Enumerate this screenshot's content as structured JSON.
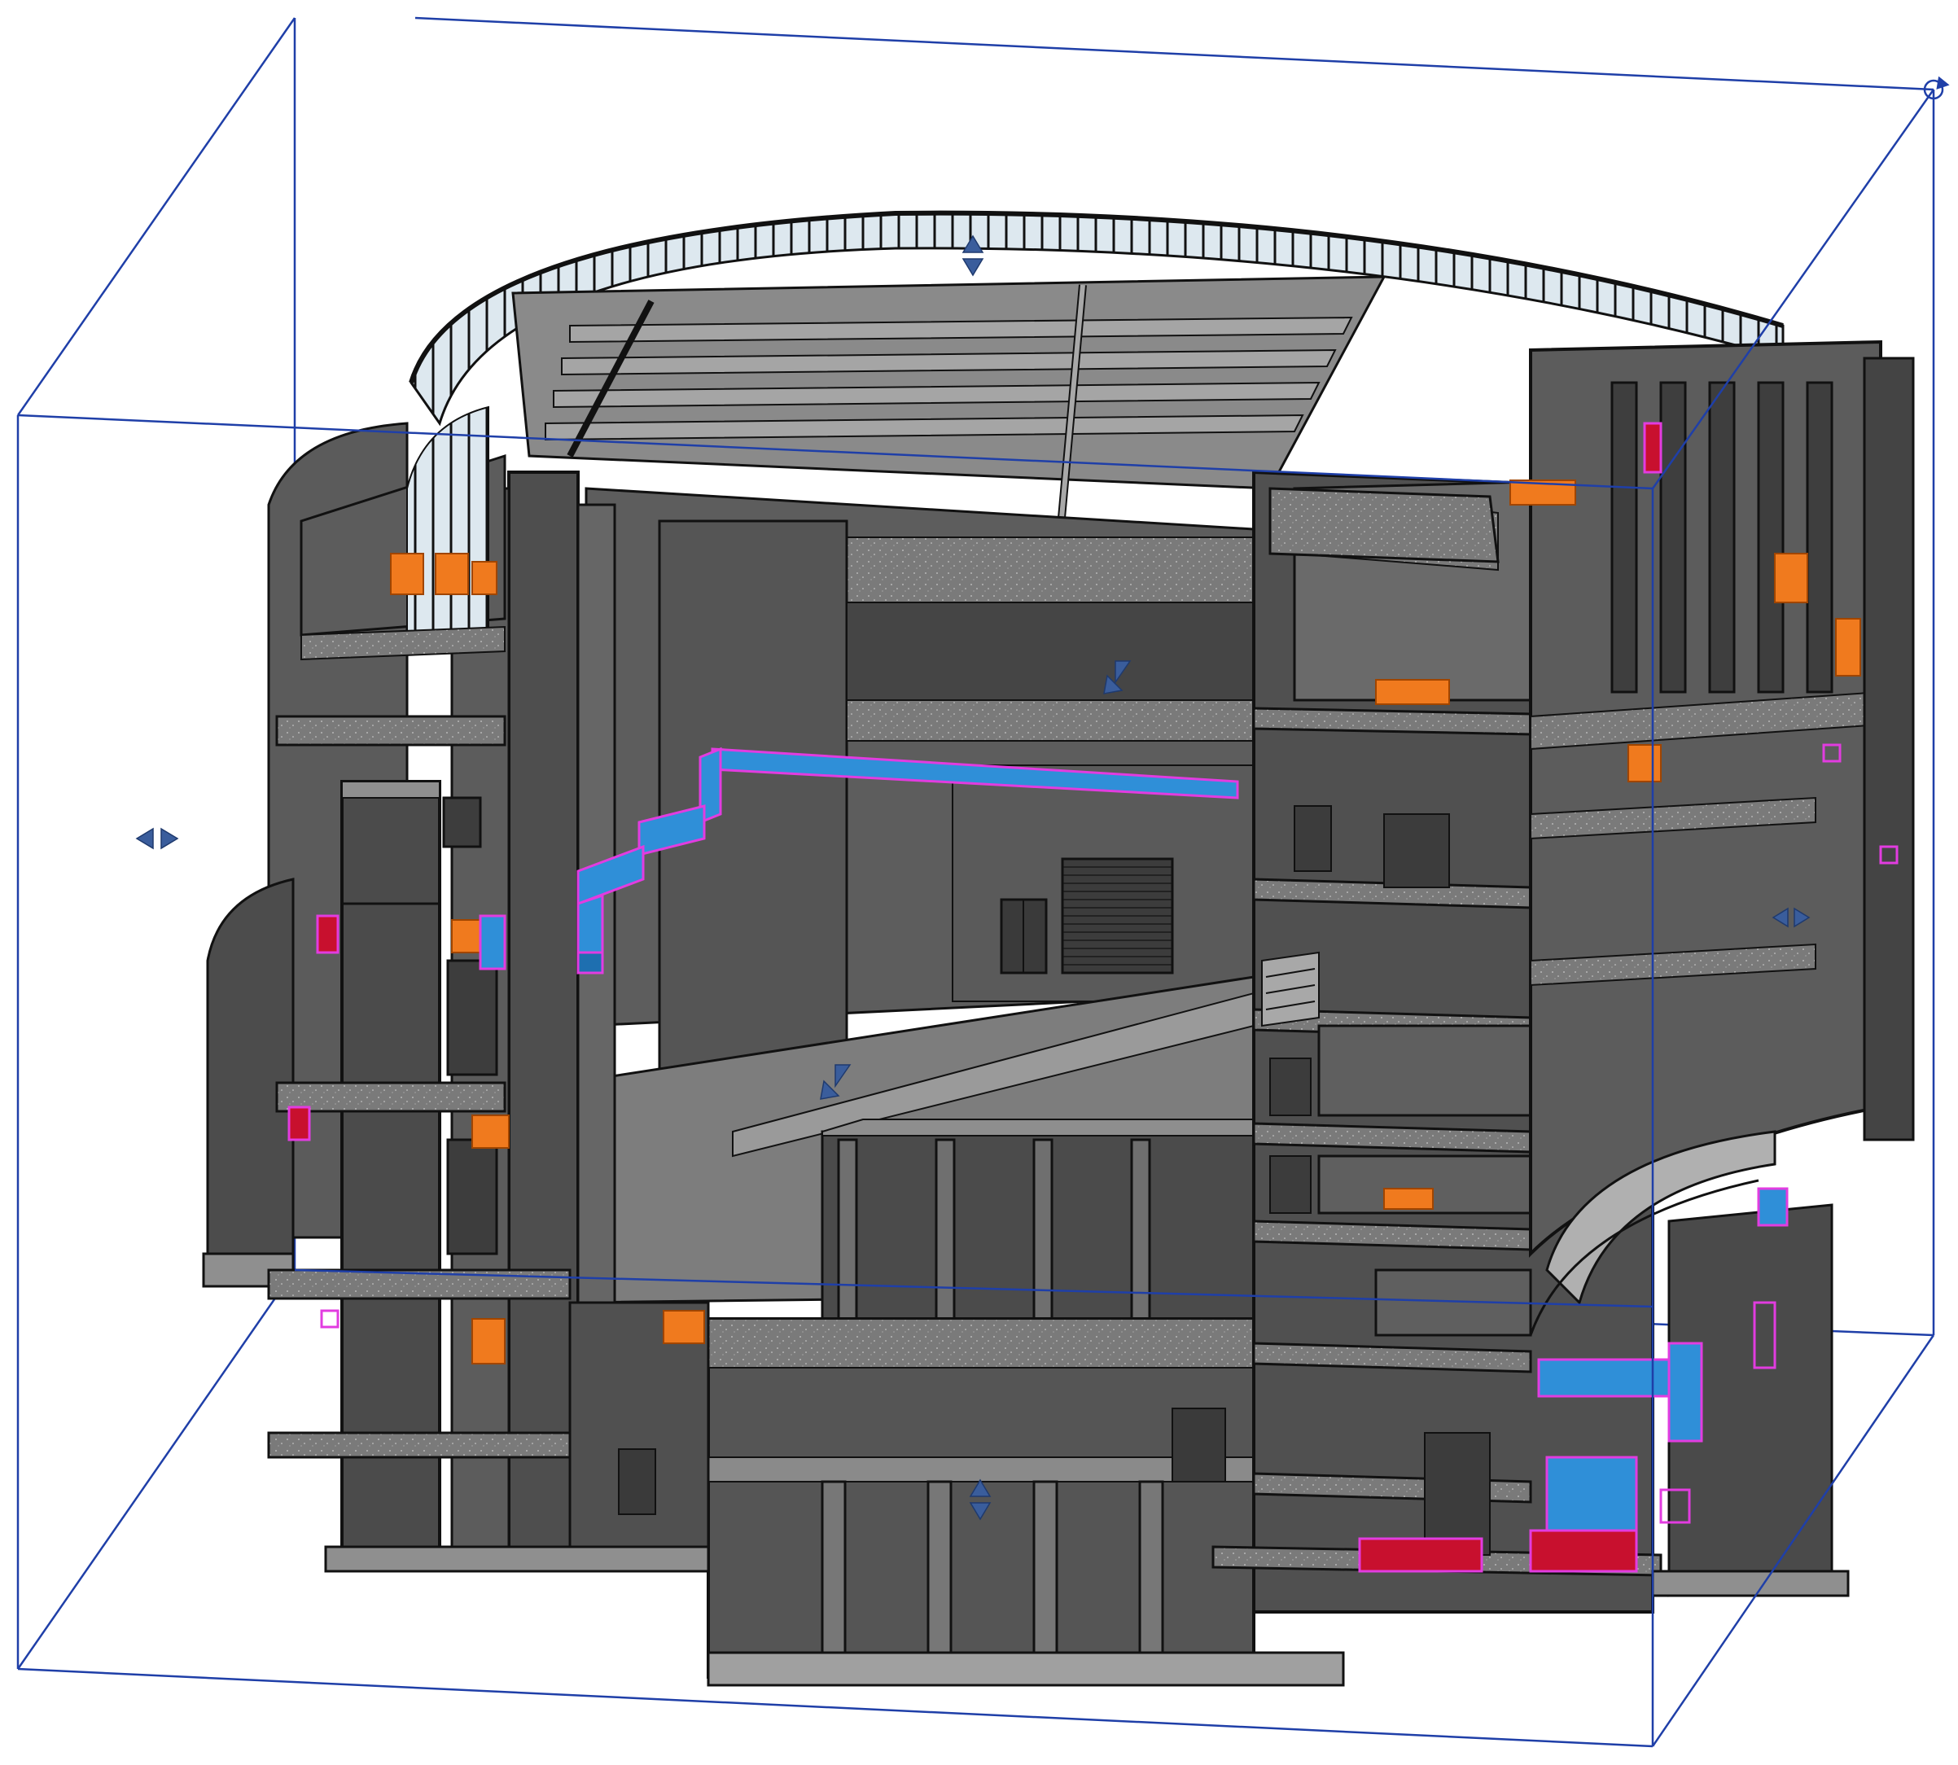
{
  "view": {
    "type": "3d-section-box-view",
    "background": "#ffffff"
  },
  "colors": {
    "section_box": "#1f3fa8",
    "grip": "#3a5d9c",
    "concrete_dark": "#4a4a4a",
    "concrete_mid": "#6b6b6b",
    "concrete_light": "#8f8f8f",
    "concrete_pale": "#b4b4b4",
    "edge": "#111111",
    "duct_blue": "#2f8fd8",
    "duct_magenta": "#e23ce0",
    "equipment_orange": "#f07a1e",
    "equipment_red": "#c8102e",
    "glass": "#dde8ef"
  },
  "grips": [
    {
      "name": "section-box-grip-top-icon",
      "kind": "up-down"
    },
    {
      "name": "section-box-grip-left-icon",
      "kind": "left-right"
    },
    {
      "name": "section-box-grip-right-icon",
      "kind": "left-right"
    },
    {
      "name": "section-box-grip-front-icon",
      "kind": "diagonal"
    },
    {
      "name": "section-box-grip-back-icon",
      "kind": "diagonal"
    },
    {
      "name": "section-box-grip-bottom-icon",
      "kind": "up-down"
    },
    {
      "name": "section-box-rotate-icon",
      "kind": "rotate"
    }
  ]
}
